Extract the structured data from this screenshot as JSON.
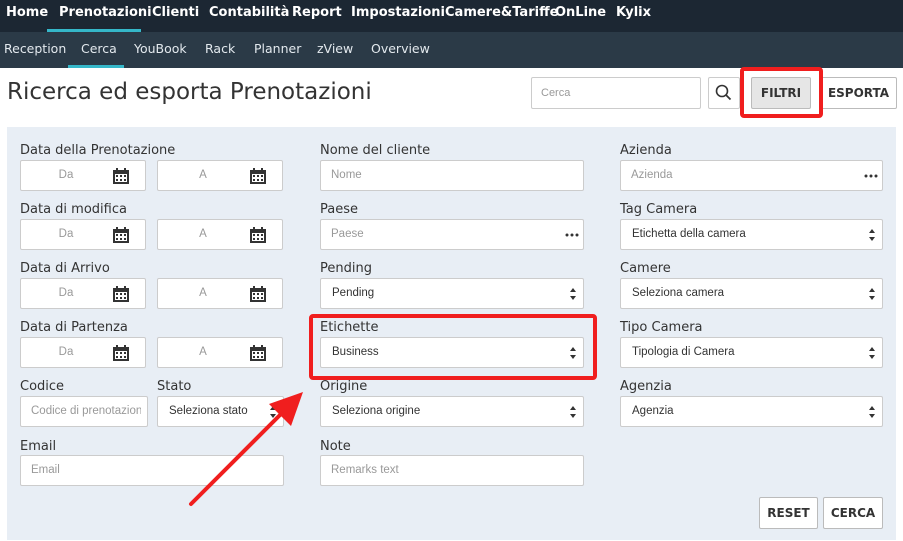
{
  "top_nav": {
    "items": [
      "Home",
      "Prenotazioni",
      "Clienti",
      "Contabilità",
      "Report",
      "Impostazioni",
      "Camere&Tariffe",
      "OnLine",
      "Kylix"
    ],
    "active": "Prenotazioni"
  },
  "sub_nav": {
    "items": [
      "Reception",
      "Cerca",
      "YouBook",
      "Rack",
      "Planner",
      "zView",
      "Overview"
    ],
    "active": "Cerca"
  },
  "header": {
    "title": "Ricerca ed esporta Prenotazioni",
    "search_placeholder": "Cerca",
    "filtri_label": "FILTRI",
    "esporta_label": "ESPORTA"
  },
  "filters": {
    "data_prenotazione": {
      "label": "Data della Prenotazione",
      "from_placeholder": "Da",
      "to_placeholder": "A"
    },
    "data_modifica": {
      "label": "Data di modifica",
      "from_placeholder": "Da",
      "to_placeholder": "A"
    },
    "data_arrivo": {
      "label": "Data di Arrivo",
      "from_placeholder": "Da",
      "to_placeholder": "A"
    },
    "data_partenza": {
      "label": "Data di Partenza",
      "from_placeholder": "Da",
      "to_placeholder": "A"
    },
    "codice": {
      "label": "Codice",
      "placeholder": "Codice di prenotazione"
    },
    "stato": {
      "label": "Stato",
      "value": "Seleziona stato"
    },
    "email": {
      "label": "Email",
      "placeholder": "Email"
    },
    "nome_cliente": {
      "label": "Nome del cliente",
      "placeholder": "Nome"
    },
    "paese": {
      "label": "Paese",
      "placeholder": "Paese"
    },
    "pending": {
      "label": "Pending",
      "value": "Pending"
    },
    "etichette": {
      "label": "Etichette",
      "value": "Business"
    },
    "origine": {
      "label": "Origine",
      "value": "Seleziona origine"
    },
    "note": {
      "label": "Note",
      "placeholder": "Remarks text"
    },
    "azienda": {
      "label": "Azienda",
      "placeholder": "Azienda"
    },
    "tag_camera": {
      "label": "Tag Camera",
      "value": "Etichetta della camera"
    },
    "camere": {
      "label": "Camere",
      "value": "Seleziona camera"
    },
    "tipo_camera": {
      "label": "Tipo Camera",
      "value": "Tipologia di Camera"
    },
    "agenzia": {
      "label": "Agenzia",
      "value": "Agenzia"
    }
  },
  "actions": {
    "reset_label": "RESET",
    "cerca_label": "CERCA"
  },
  "colors": {
    "nav_bg": "#1c2733",
    "subnav_bg": "#2b3a47",
    "accent": "#35b7c9",
    "panel_bg": "#e8eef5",
    "highlight": "#f01e1e"
  }
}
